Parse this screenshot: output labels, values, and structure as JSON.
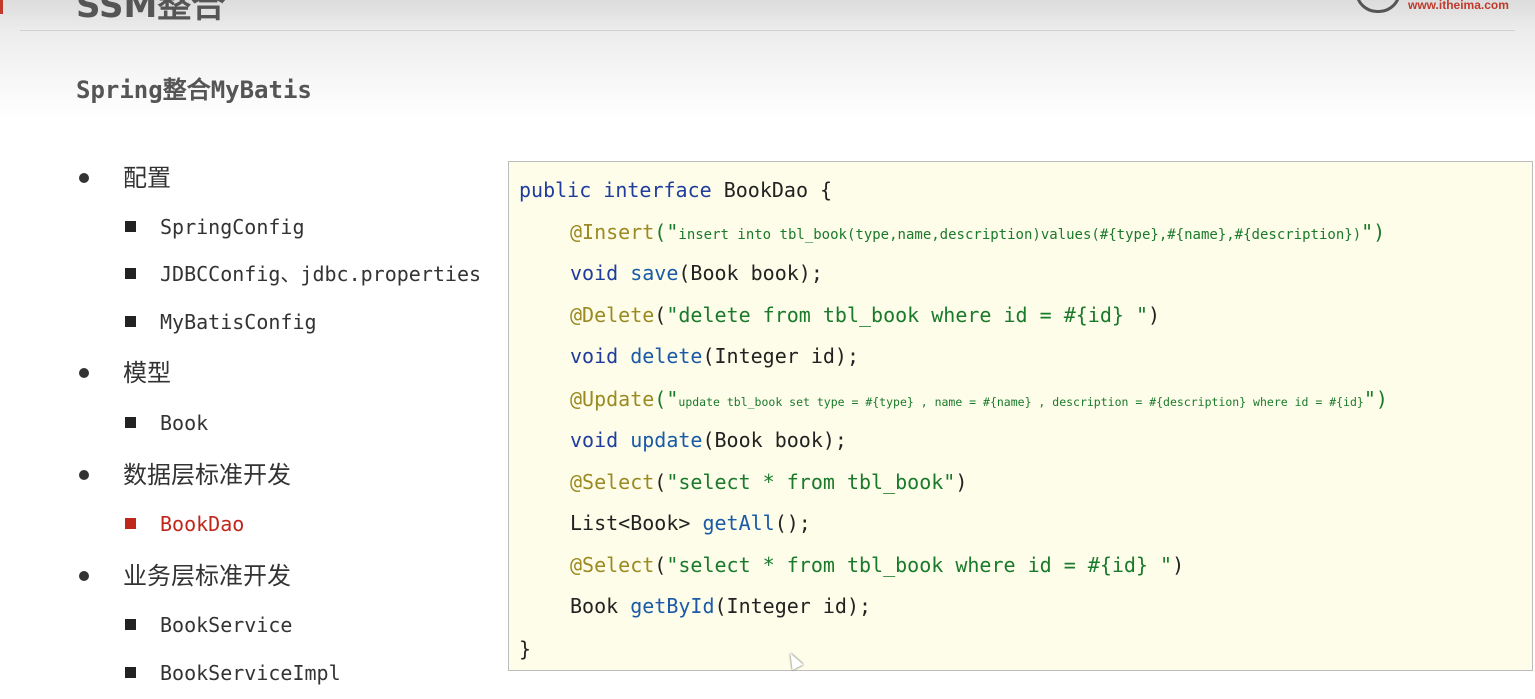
{
  "header": {
    "title": "SSM整合",
    "logo_url": "www.itheima.com"
  },
  "subtitle": "Spring整合MyBatis",
  "outline": [
    {
      "label": "配置",
      "children": [
        {
          "label": "SpringConfig",
          "active": false
        },
        {
          "label": "JDBCConfig、jdbc.properties",
          "active": false
        },
        {
          "label": "MyBatisConfig",
          "active": false
        }
      ]
    },
    {
      "label": "模型",
      "children": [
        {
          "label": "Book",
          "active": false
        }
      ]
    },
    {
      "label": "数据层标准开发",
      "children": [
        {
          "label": "BookDao",
          "active": true
        }
      ]
    },
    {
      "label": "业务层标准开发",
      "children": [
        {
          "label": "BookService",
          "active": false
        },
        {
          "label": "BookServiceImpl",
          "active": false
        }
      ]
    }
  ],
  "code": {
    "line1": {
      "kw1": "public",
      "kw2": "interface",
      "name": "BookDao {"
    },
    "insert": {
      "ann": "@Insert",
      "open": "(\"",
      "sql": "insert into tbl_book(type,name,description)values(#{type},#{name},#{description})",
      "close": "\")"
    },
    "save": {
      "kw": "void",
      "fn": "save",
      "args": "(Book book);"
    },
    "delete_ann": {
      "ann": "@Delete",
      "open": "(",
      "str": "\"delete from tbl_book where id = #{id} \"",
      "close": ")"
    },
    "delete": {
      "kw": "void",
      "fn": "delete",
      "args": "(Integer id);"
    },
    "update_ann": {
      "ann": "@Update",
      "open": "(\"",
      "sql": "update tbl_book set type = #{type} , name = #{name} , description = #{description} where id = #{id}",
      "close": "\")"
    },
    "update": {
      "kw": "void",
      "fn": "update",
      "args": "(Book book);"
    },
    "select_all_ann": {
      "ann": "@Select",
      "open": "(",
      "str": "\"select * from tbl_book\"",
      "close": ")"
    },
    "get_all": {
      "type": "List<Book> ",
      "fn": "getAll",
      "args": "();"
    },
    "select_id_ann": {
      "ann": "@Select",
      "open": "(",
      "str": "\"select * from tbl_book where id = #{id} \"",
      "close": ")"
    },
    "get_by_id": {
      "type": "Book ",
      "fn": "getById",
      "args": "(Integer id);"
    },
    "close": "}"
  }
}
